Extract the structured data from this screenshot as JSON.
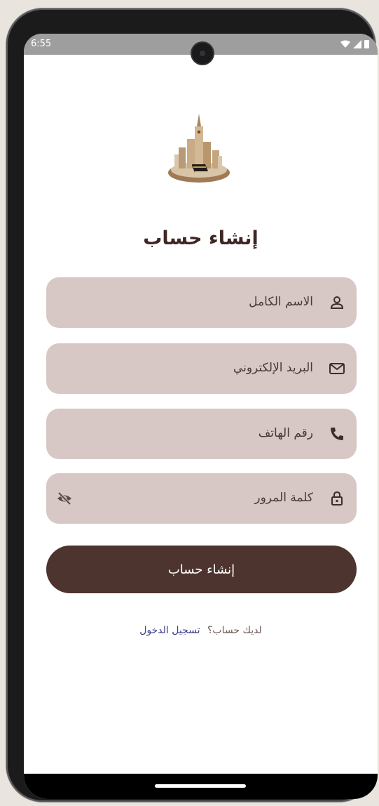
{
  "status": {
    "time": "6:55"
  },
  "page": {
    "title": "إنشاء حساب"
  },
  "fields": [
    {
      "label": "الاسم الكامل",
      "icon": "person-icon"
    },
    {
      "label": "البريد الإلكتروني",
      "icon": "mail-icon"
    },
    {
      "label": "رقم الهاتف",
      "icon": "phone-icon"
    },
    {
      "label": "كلمة المرور",
      "icon": "lock-icon",
      "toggle_icon": "eye-off-icon"
    }
  ],
  "submit": {
    "label": "إنشاء حساب"
  },
  "footer": {
    "question": "لديك حساب؟",
    "link": "تسجيل الدخول"
  },
  "colors": {
    "field_bg": "#d7c8c5",
    "button_bg": "#4e342e",
    "title": "#3e2723",
    "link": "#3c3c8c"
  }
}
